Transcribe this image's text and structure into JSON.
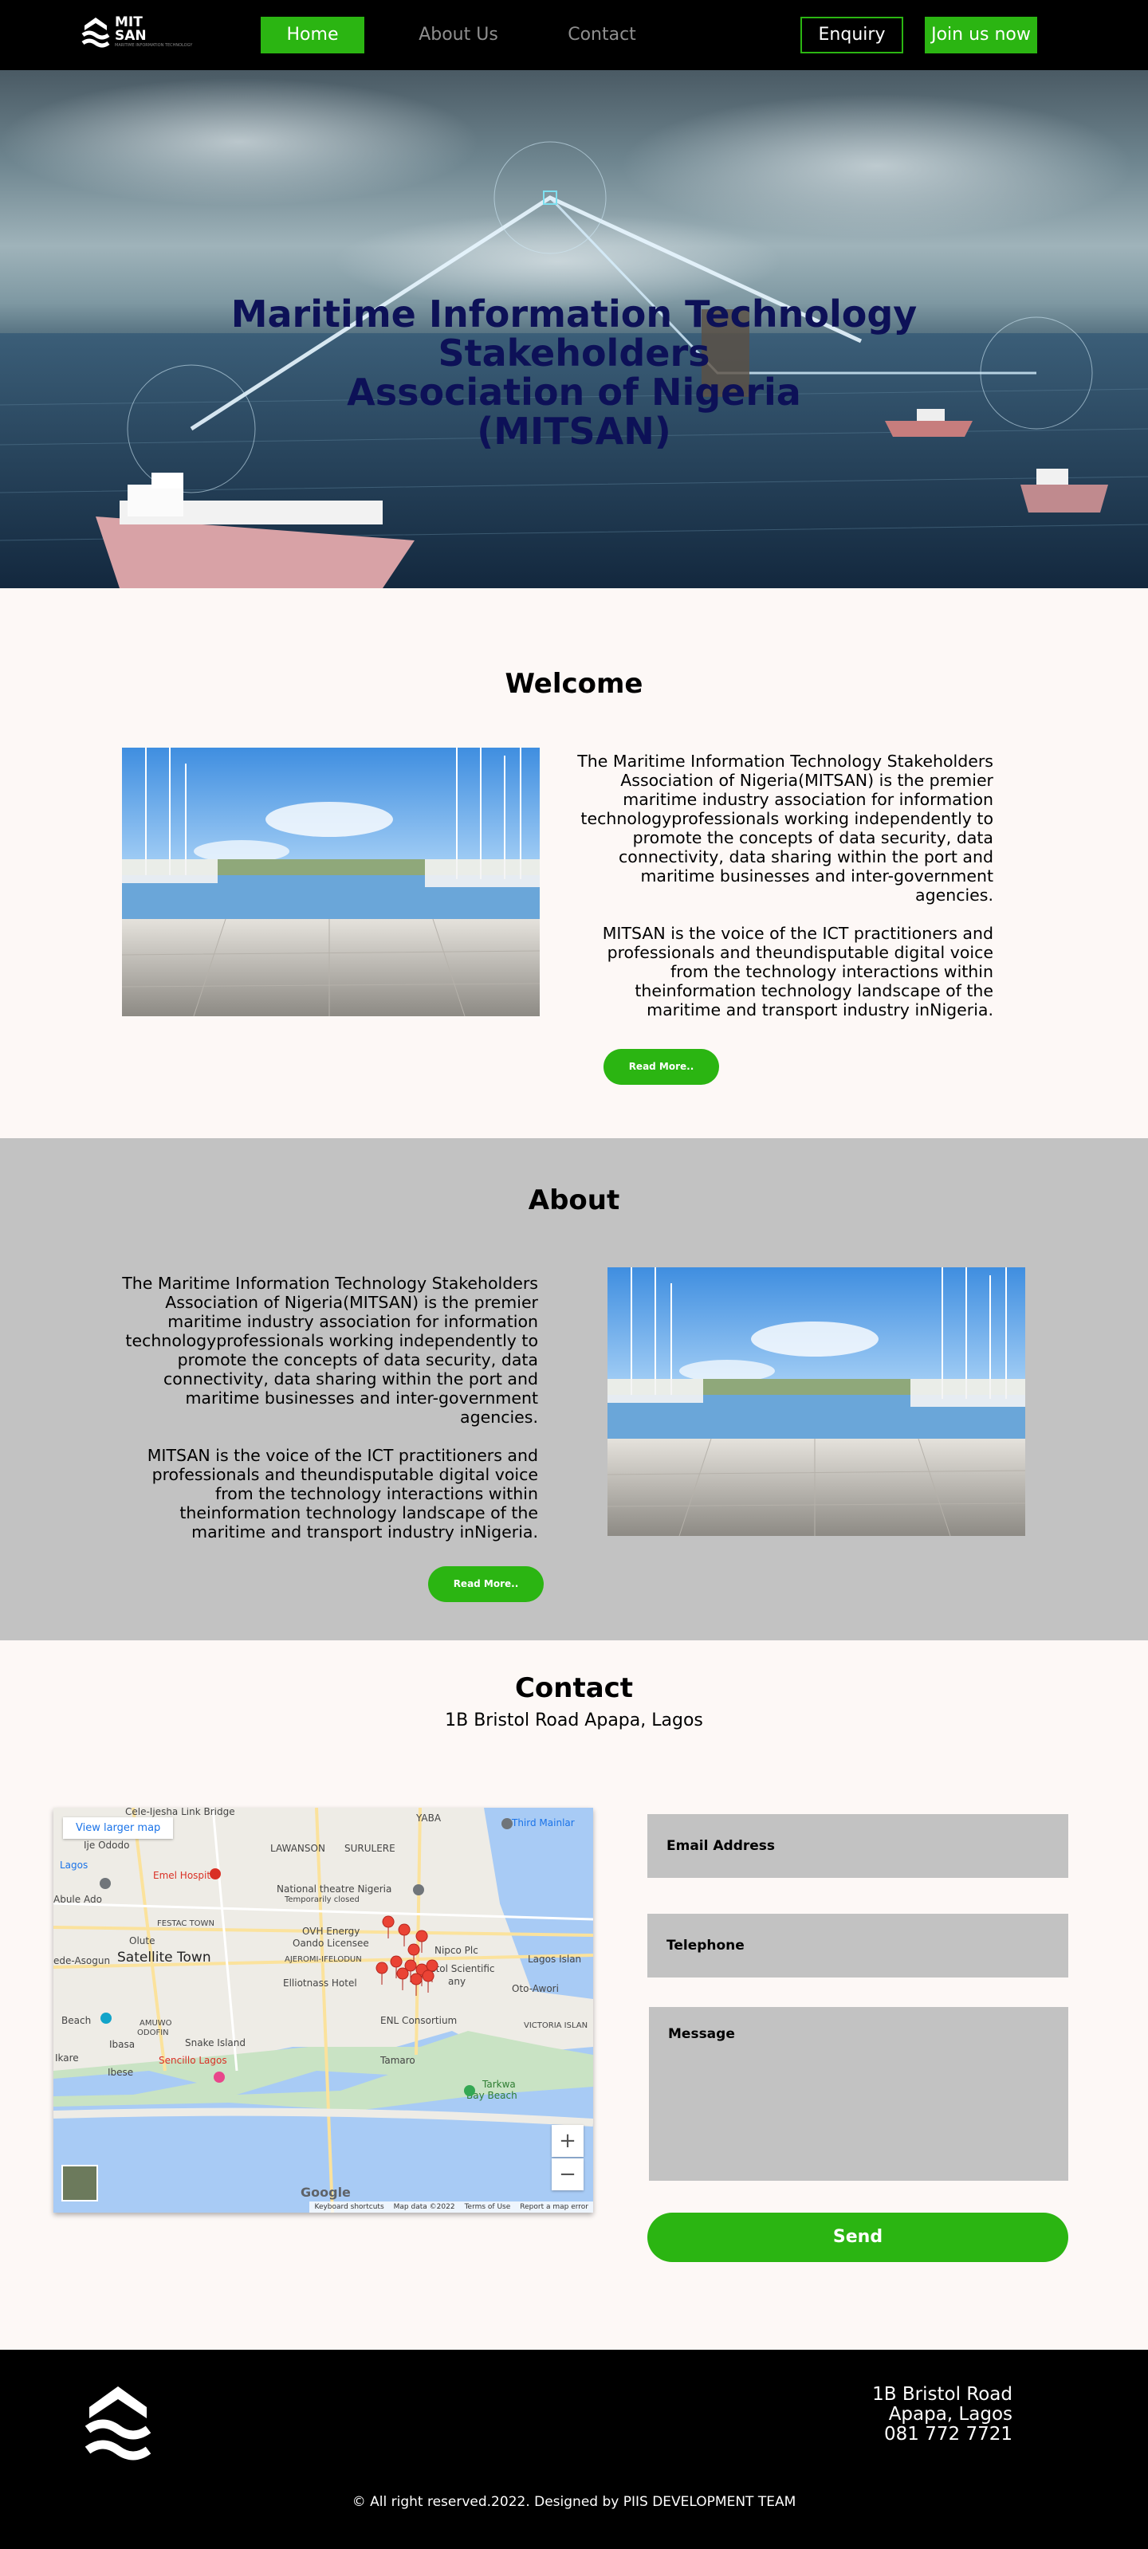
{
  "nav": {
    "home": "Home",
    "about": "About Us",
    "contact": "Contact",
    "enquiry": "Enquiry",
    "join": "Join us now"
  },
  "logo": {
    "line1": "MIT",
    "line2": "SAN",
    "sub": "MARITIME INFORMATION TECHNOLOGY"
  },
  "hero": {
    "title_line1": "Maritime Information Technology Stakeholders",
    "title_line2": "Association of Nigeria",
    "title_line3": "(MITSAN)"
  },
  "welcome": {
    "title": "Welcome",
    "para1": "The Maritime Information Technology Stakeholders Association of Nigeria(MITSAN) is the premier maritime industry association for information technologyprofessionals working independently to promote the concepts of data security, data connectivity, data sharing within the port and maritime businesses and inter-government agencies.",
    "para2": "MITSAN is the voice of the ICT practitioners and professionals and theundisputable digital voice from the technology interactions within theinformation technology landscape of the maritime and transport industry inNigeria.",
    "read_more": "Read More.."
  },
  "about": {
    "title": "About",
    "para1": "The Maritime Information Technology Stakeholders Association of Nigeria(MITSAN) is the premier maritime industry association for information technologyprofessionals working independently to promote the concepts of data security, data connectivity, data sharing within the port and maritime businesses and inter-government agencies.",
    "para2": "MITSAN is the voice of the ICT practitioners and professionals and theundisputable digital voice from the technology interactions within theinformation technology landscape of the maritime and transport industry inNigeria.",
    "read_more": "Read More.."
  },
  "contact": {
    "title": "Contact",
    "address": "1B Bristol Road Apapa, Lagos",
    "email_placeholder": "Email Address",
    "telephone_placeholder": "Telephone",
    "message_placeholder": "Message",
    "send": "Send"
  },
  "map": {
    "view_larger": "View larger map",
    "labels": {
      "link_bridge": "Cele-Ijesha Link Bridge",
      "ije_ododo": "Ije Ododo",
      "yaba": "YABA",
      "third_mainland": "Third Mainlar",
      "lagos": "Lagos",
      "lawanson": "LAWANSON",
      "surulere": "SURULERE",
      "abule_ado": "Abule Ado",
      "emel": "Emel Hospital",
      "theatre": "National theatre Nigeria",
      "temp_closed": "Temporarily closed",
      "festac": "FESTAC TOWN",
      "olute": "Olute",
      "ovh": "OVH Energy",
      "oando": "Oando Licensee",
      "ajeromi": "AJEROMI-IFELODUN",
      "asogun": "ede-Asogun",
      "satellite": "Satellite Town",
      "nipco": "Nipco Plc",
      "lagos_island": "Lagos Islan",
      "elliotnass": "Elliotnass Hotel",
      "scientific": "istol Scientific",
      "any": "any",
      "oto_awori": "Oto-Awori",
      "amuwo": "AMUWO",
      "odofin": "ODOFIN",
      "enl": "ENL Consortium",
      "victoria": "VICTORIA ISLAN",
      "beach": "Beach",
      "snake": "Snake Island",
      "ikare": "Ikare",
      "sencillo": "Sencillo Lagos",
      "tamaro": "Tamaro",
      "ibasa": "Ibasa",
      "ibese": "Ibese",
      "tarkwa1": "Tarkwa",
      "tarkwa2": "Bay Beach"
    },
    "zoom_in": "+",
    "zoom_out": "−",
    "google": "Google",
    "footer_items": [
      "Keyboard shortcuts",
      "Map data ©2022",
      "Terms of Use",
      "Report a map error"
    ]
  },
  "footer": {
    "address_line1": "1B Bristol Road",
    "address_line2": "Apapa, Lagos",
    "phone": "081 772 7721",
    "copyright_icon": "copyright-icon",
    "copyright": "All right reserved.2022. Designed by PIIS DEVELOPMENT TEAM"
  },
  "colors": {
    "accent_green": "#2bb512",
    "nav_bg": "#000000",
    "hero_title": "#0d1157",
    "about_bg": "#c2c2c2",
    "page_bg": "#fdf8f6"
  }
}
